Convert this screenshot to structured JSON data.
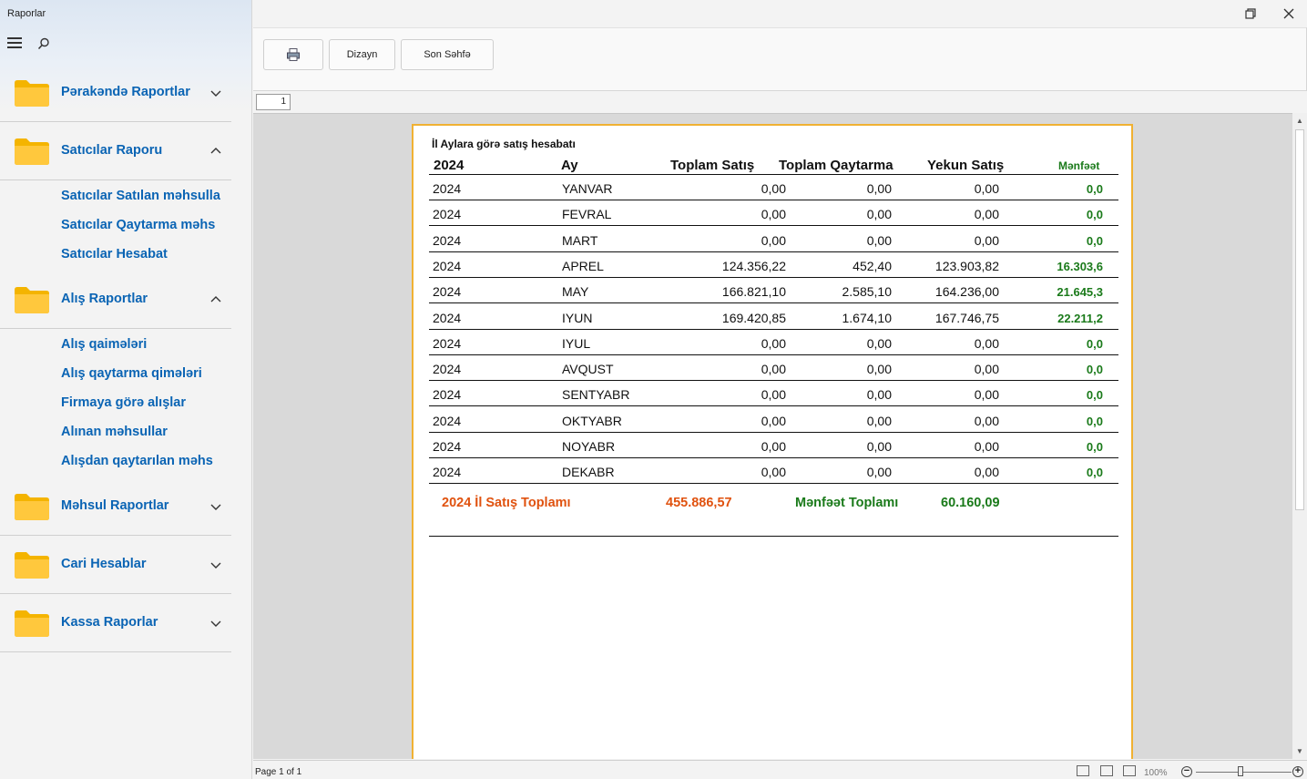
{
  "app": {
    "title": "Raporlar"
  },
  "sidebar": {
    "groups": [
      {
        "label": "Pərakəndə Raportlar",
        "expanded": false,
        "items": []
      },
      {
        "label": "Satıcılar Raporu",
        "expanded": true,
        "items": [
          "Satıcılar Satılan məhsulla",
          "Satıcılar Qaytarma məhs",
          "Satıcılar Hesabat"
        ]
      },
      {
        "label": "Alış Raportlar",
        "expanded": true,
        "items": [
          "Alış qaimələri",
          "Alış qaytarma qimələri",
          "Firmaya görə alışlar",
          "Alınan məhsullar",
          "Alışdan qaytarılan məhs"
        ]
      },
      {
        "label": "Məhsul Raportlar",
        "expanded": false,
        "items": []
      },
      {
        "label": "Cari Hesablar",
        "expanded": false,
        "items": []
      },
      {
        "label": "Kassa Raporlar",
        "expanded": false,
        "items": []
      }
    ]
  },
  "toolbar": {
    "print_icon": "printer-icon",
    "design_label": "Dizayn",
    "last_page_label": "Son Səhfə"
  },
  "page_number": "1",
  "report": {
    "title": "İl  Aylara görə satış  hesabatı",
    "columns": [
      "2024",
      "Ay",
      "Toplam Satış",
      "Toplam Qaytarma",
      "Yekun Satış",
      "Mənfəət"
    ],
    "rows": [
      [
        "2024",
        "YANVAR",
        "0,00",
        "0,00",
        "0,00",
        "0,0"
      ],
      [
        "2024",
        "FEVRAL",
        "0,00",
        "0,00",
        "0,00",
        "0,0"
      ],
      [
        "2024",
        "MART",
        "0,00",
        "0,00",
        "0,00",
        "0,0"
      ],
      [
        "2024",
        "APREL",
        "124.356,22",
        "452,40",
        "123.903,82",
        "16.303,6"
      ],
      [
        "2024",
        "MAY",
        "166.821,10",
        "2.585,10",
        "164.236,00",
        "21.645,3"
      ],
      [
        "2024",
        "IYUN",
        "169.420,85",
        "1.674,10",
        "167.746,75",
        "22.211,2"
      ],
      [
        "2024",
        "IYUL",
        "0,00",
        "0,00",
        "0,00",
        "0,0"
      ],
      [
        "2024",
        "AVQUST",
        "0,00",
        "0,00",
        "0,00",
        "0,0"
      ],
      [
        "2024",
        "SENTYABR",
        "0,00",
        "0,00",
        "0,00",
        "0,0"
      ],
      [
        "2024",
        "OKTYABR",
        "0,00",
        "0,00",
        "0,00",
        "0,0"
      ],
      [
        "2024",
        "NOYABR",
        "0,00",
        "0,00",
        "0,00",
        "0,0"
      ],
      [
        "2024",
        "DEKABR",
        "0,00",
        "0,00",
        "0,00",
        "0,0"
      ]
    ],
    "totals": {
      "year_label": "2024  İl Satış Toplamı",
      "year_value": "455.886,57",
      "profit_label": "Mənfəət Toplamı",
      "profit_value": "60.160,09"
    },
    "colors": {
      "total_orange": "#e0520f",
      "profit_green": "#1a7a1a",
      "link_blue": "#0a64b4"
    }
  },
  "status": {
    "page_text": "Page 1 of 1",
    "zoom": "100%"
  }
}
